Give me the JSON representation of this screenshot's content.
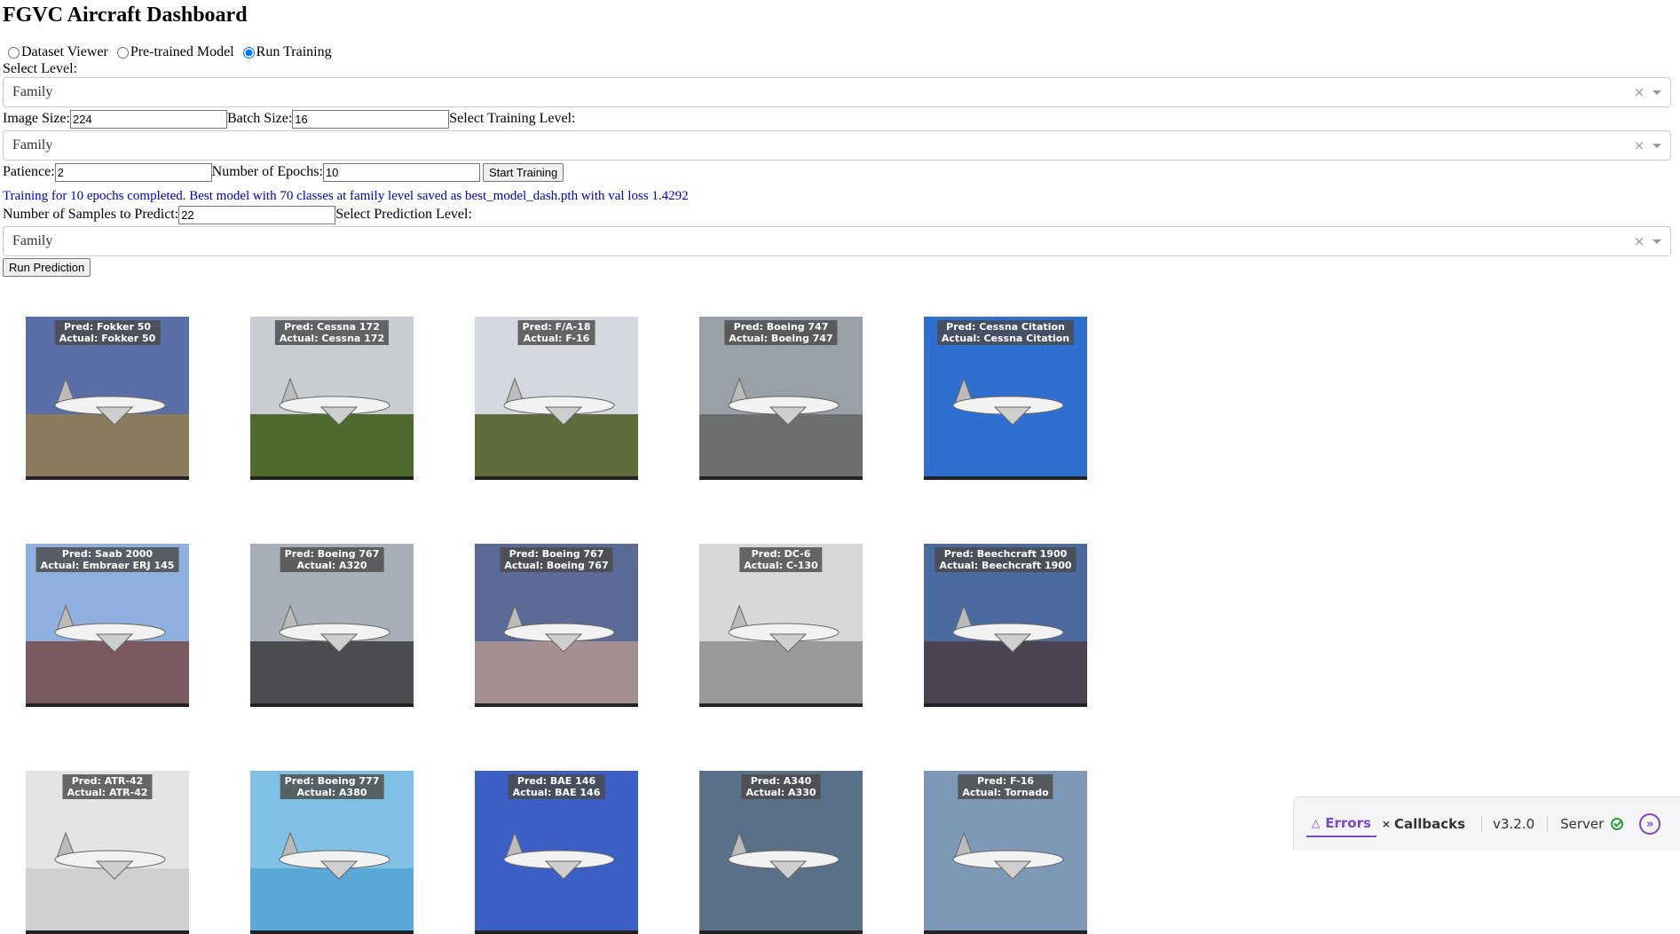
{
  "title": "FGVC Aircraft Dashboard",
  "modes": [
    {
      "label": "Dataset Viewer",
      "checked": false
    },
    {
      "label": "Pre-trained Model",
      "checked": false
    },
    {
      "label": "Run Training",
      "checked": true
    }
  ],
  "select_level": {
    "label": "Select Level:",
    "value": "Family"
  },
  "training": {
    "image_size_label": "Image Size:",
    "image_size_value": "224",
    "batch_size_label": "Batch Size:",
    "batch_size_value": "16",
    "level_label": "Select Training Level:",
    "level_value": "Family",
    "patience_label": "Patience:",
    "patience_value": "2",
    "epochs_label": "Number of Epochs:",
    "epochs_value": "10",
    "start_button": "Start Training",
    "status": "Training for 10 epochs completed. Best model with 70 classes at family level saved as best_model_dash.pth with val loss 1.4292"
  },
  "prediction": {
    "samples_label": "Number of Samples to Predict:",
    "samples_value": "22",
    "level_label": "Select Prediction Level:",
    "level_value": "Family",
    "run_button": "Run Prediction"
  },
  "results": [
    {
      "pred": "Pred: Fokker 50",
      "actual": "Actual: Fokker 50",
      "sky": "#5a6fa8",
      "ground": "#8a7a5e"
    },
    {
      "pred": "Pred: Cessna 172",
      "actual": "Actual: Cessna 172",
      "sky": "#c9ccd0",
      "ground": "#4f6a2e"
    },
    {
      "pred": "Pred: F/A-18",
      "actual": "Actual: F-16",
      "sky": "#d5d8de",
      "ground": "#5e6b3a"
    },
    {
      "pred": "Pred: Boeing 747",
      "actual": "Actual: Boeing 747",
      "sky": "#9aa0a8",
      "ground": "#6d6e70"
    },
    {
      "pred": "Pred: Cessna Citation",
      "actual": "Actual: Cessna Citation",
      "sky": "#2f6fd0",
      "ground": "#2f6fd0"
    },
    {
      "pred": "Pred: Saab 2000",
      "actual": "Actual: Embraer ERJ 145",
      "sky": "#8fb0de",
      "ground": "#7a5a5e"
    },
    {
      "pred": "Pred: Boeing 767",
      "actual": "Actual: A320",
      "sky": "#a9afb8",
      "ground": "#4a4c50"
    },
    {
      "pred": "Pred: Boeing 767",
      "actual": "Actual: Boeing 767",
      "sky": "#5b6a96",
      "ground": "#a48f93"
    },
    {
      "pred": "Pred: DC-6",
      "actual": "Actual: C-130",
      "sky": "#d8d8d8",
      "ground": "#9a9a9a"
    },
    {
      "pred": "Pred: Beechcraft 1900",
      "actual": "Actual: Beechcraft 1900",
      "sky": "#4a6aa0",
      "ground": "#4c4452"
    },
    {
      "pred": "Pred: ATR-42",
      "actual": "Actual: ATR-42",
      "sky": "#e4e4e4",
      "ground": "#d0d0d0"
    },
    {
      "pred": "Pred: Boeing 777",
      "actual": "Actual: A380",
      "sky": "#7fc0e4",
      "ground": "#5aa8d8"
    },
    {
      "pred": "Pred: BAE 146",
      "actual": "Actual: BAE 146",
      "sky": "#3b5fc4",
      "ground": "#3b5fc4"
    },
    {
      "pred": "Pred: A340",
      "actual": "Actual: A330",
      "sky": "#5a6f88",
      "ground": "#5a6f88"
    },
    {
      "pred": "Pred: F-16",
      "actual": "Actual: Tornado",
      "sky": "#7e99b8",
      "ground": "#7e99b8"
    }
  ],
  "debug": {
    "errors_label": "Errors",
    "callbacks_label": "Callbacks",
    "version": "v3.2.0",
    "server_label": "Server"
  }
}
